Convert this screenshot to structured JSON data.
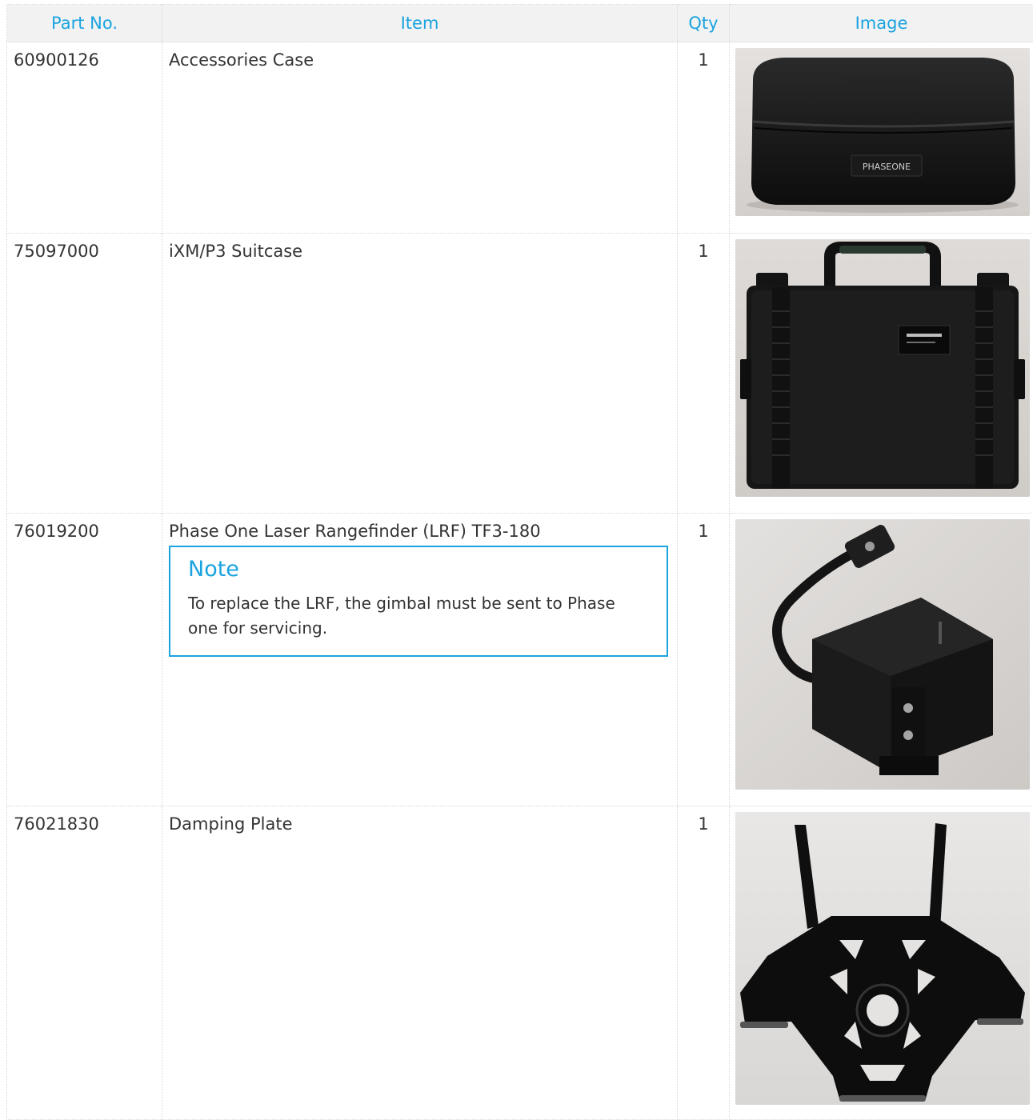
{
  "table": {
    "headers": {
      "part_no": "Part No.",
      "item": "Item",
      "qty": "Qty",
      "image": "Image"
    },
    "rows": [
      {
        "part_no": "60900126",
        "item": "Accessories Case",
        "qty": "1"
      },
      {
        "part_no": "75097000",
        "item": "iXM/P3 Suitcase",
        "qty": "1"
      },
      {
        "part_no": "76019200",
        "item": "Phase One Laser Rangefinder (LRF) TF3-180",
        "qty": "1",
        "note": {
          "title": "Note",
          "body": "To replace the LRF, the gimbal must be sent to Phase one for servicing."
        }
      },
      {
        "part_no": "76021830",
        "item": "Damping Plate",
        "qty": "1"
      }
    ]
  },
  "colors": {
    "accent": "#1aa3e0",
    "header_bg": "#f2f2f2",
    "text": "#333333"
  }
}
